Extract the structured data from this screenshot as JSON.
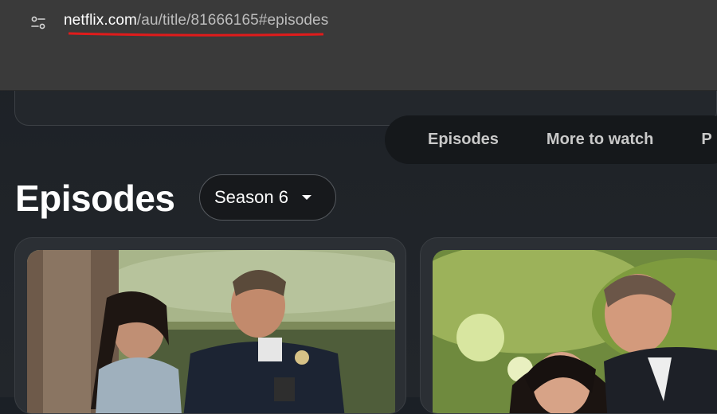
{
  "browser": {
    "url_host": "netflix.com",
    "url_path": "/au/title/81666165#episodes",
    "site_info_icon": "tune-icon"
  },
  "page": {
    "tabs": [
      "Episodes",
      "More to watch",
      "P"
    ],
    "episodes_heading": "Episodes",
    "season_select": {
      "value": "Season 6",
      "caret_icon": "caret-down-icon"
    }
  },
  "colors": {
    "annotation_underline": "#e01b1b",
    "tab_bar_bg": "#15181b"
  }
}
